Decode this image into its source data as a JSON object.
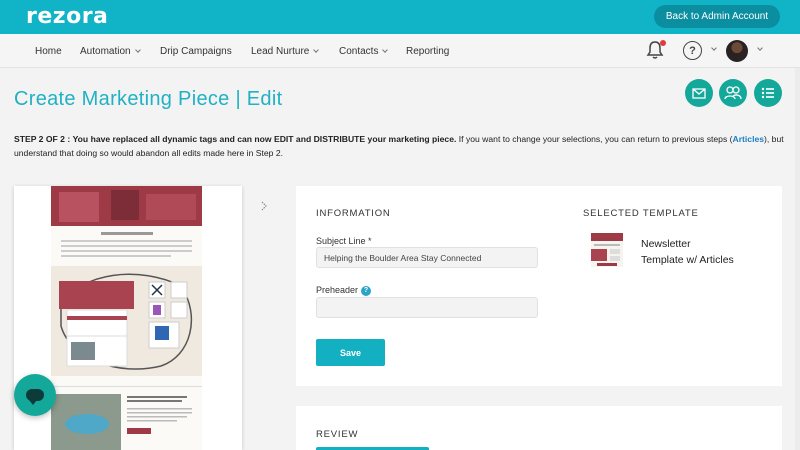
{
  "header": {
    "logo": "rezora",
    "back_button": "Back to Admin Account"
  },
  "nav": {
    "items": [
      {
        "label": "Home",
        "has_dropdown": false
      },
      {
        "label": "Automation",
        "has_dropdown": true
      },
      {
        "label": "Drip Campaigns",
        "has_dropdown": false
      },
      {
        "label": "Lead Nurture",
        "has_dropdown": true
      },
      {
        "label": "Contacts",
        "has_dropdown": true
      },
      {
        "label": "Reporting",
        "has_dropdown": false
      }
    ],
    "icons": [
      "bell-icon",
      "help-icon",
      "avatar"
    ],
    "help_glyph": "?"
  },
  "page": {
    "title": "Create Marketing Piece | Edit",
    "action_icons": [
      "email-icon",
      "contacts-icon",
      "list-icon"
    ]
  },
  "step": {
    "label": "STEP 2 OF 2 :",
    "bold_message": "You have replaced all dynamic tags and can now EDIT and DISTRIBUTE your marketing piece.",
    "message": "If you want to change your selections, you can return to previous steps (",
    "link": "Articles",
    "message_end": "), but understand that doing so would abandon all edits made here in Step 2."
  },
  "information": {
    "heading": "INFORMATION",
    "subject_label": "Subject Line *",
    "subject_value": "Helping the Boulder Area Stay Connected",
    "preheader_label": "Preheader",
    "info_glyph": "?",
    "save_label": "Save"
  },
  "selected_template": {
    "heading": "SELECTED TEMPLATE",
    "name_line1": "Newsletter",
    "name_line2": "Template w/ Articles"
  },
  "review": {
    "heading": "REVIEW"
  },
  "colors": {
    "brand": "#11b3c7",
    "accent_green": "#14a89a",
    "link": "#1a7fc4"
  }
}
